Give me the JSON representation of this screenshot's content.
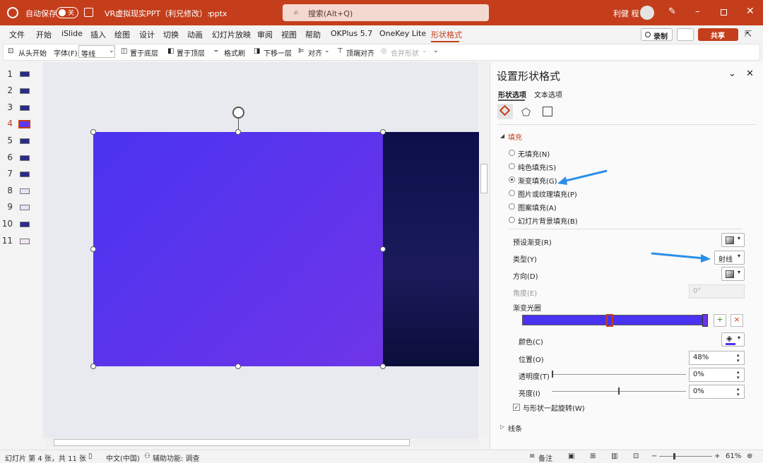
{
  "titlebar": {
    "autosave_label": "自动保存",
    "autosave_state": "关",
    "filename": "VR虚拟现实PPT（利兄修改）.pptx",
    "search_placeholder": "搜索(Alt+Q)",
    "user_name": "利健 程"
  },
  "menu": {
    "items": [
      "文件",
      "开始",
      "iSlide",
      "插入",
      "绘图",
      "设计",
      "切换",
      "动画",
      "幻灯片放映",
      "审阅",
      "视图",
      "帮助",
      "OKPlus 5.7",
      "OneKey Lite",
      "形状格式"
    ],
    "record": "录制",
    "share": "共享"
  },
  "toolbar": {
    "from_start": "从头开始",
    "font_label": "字体(F):",
    "font_value": "等线",
    "send_to_back": "置于底层",
    "bring_to_front": "置于顶层",
    "format_painter": "格式刷",
    "send_backward": "下移一层",
    "align": "对齐",
    "top_align": "顶端对齐",
    "merge_shapes": "合并形状"
  },
  "thumbnails": [
    "1",
    "2",
    "3",
    "4",
    "5",
    "6",
    "7",
    "8",
    "9",
    "10",
    "11"
  ],
  "selected_slide": "4",
  "panel": {
    "title": "设置形状格式",
    "tab_shape": "形状选项",
    "tab_text": "文本选项",
    "fill_section": "填充",
    "fill_options": [
      "无填充(N)",
      "纯色填充(S)",
      "渐变填充(G)",
      "图片或纹理填充(P)",
      "图案填充(A)",
      "幻灯片背景填充(B)"
    ],
    "selected_fill": "渐变填充(G)",
    "preset_gradient": "预设渐变(R)",
    "type_label": "类型(Y)",
    "type_value": "射线",
    "direction_label": "方向(D)",
    "angle_label": "角度(E)",
    "angle_value": "0°",
    "gradient_stops_label": "渐变光圈",
    "color_label": "颜色(C)",
    "position_label": "位置(O)",
    "position_value": "48%",
    "transparency_label": "透明度(T)",
    "transparency_value": "0%",
    "brightness_label": "亮度(I)",
    "brightness_value": "0%",
    "rotate_with_shape": "与形状一起旋转(W)",
    "line_section": "线条"
  },
  "statusbar": {
    "slide_info": "幻灯片 第 4 张，共 11 张",
    "language": "中文(中国)",
    "accessibility": "辅助功能: 调查",
    "notes": "备注",
    "zoom": "61%"
  },
  "colors": {
    "accent": "#c43e1c",
    "slide_gradient_start": "#4a33f0",
    "slide_gradient_end": "#6e35e8",
    "arrow": "#2b8fe8"
  }
}
